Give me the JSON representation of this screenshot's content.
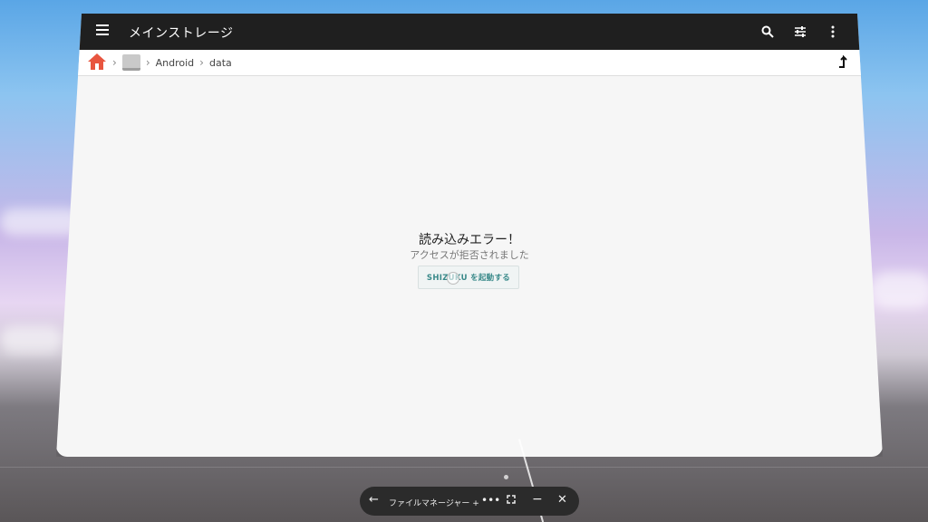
{
  "appbar": {
    "title": "メインストレージ",
    "icons": [
      "menu-icon",
      "search-icon",
      "tune-icon",
      "more-vert-icon"
    ]
  },
  "breadcrumb": {
    "items": [
      "Android",
      "data"
    ],
    "icons": [
      "home-icon",
      "storage-icon",
      "up-arrow-icon"
    ]
  },
  "error": {
    "title": "読み込みエラー！",
    "subtitle": "アクセスが拒否されました",
    "button_label": "SHIZUKU を起動する"
  },
  "taskbar": {
    "app_title": "ファイルマネージャー +",
    "more_label": "•••",
    "icons": [
      "back-arrow-icon",
      "more-icon",
      "expand-icon",
      "minimize-icon",
      "close-icon"
    ]
  },
  "colors": {
    "appbar_bg": "#1f1f1f",
    "accent": "#3a8a8a",
    "home_icon": "#e8553f"
  }
}
